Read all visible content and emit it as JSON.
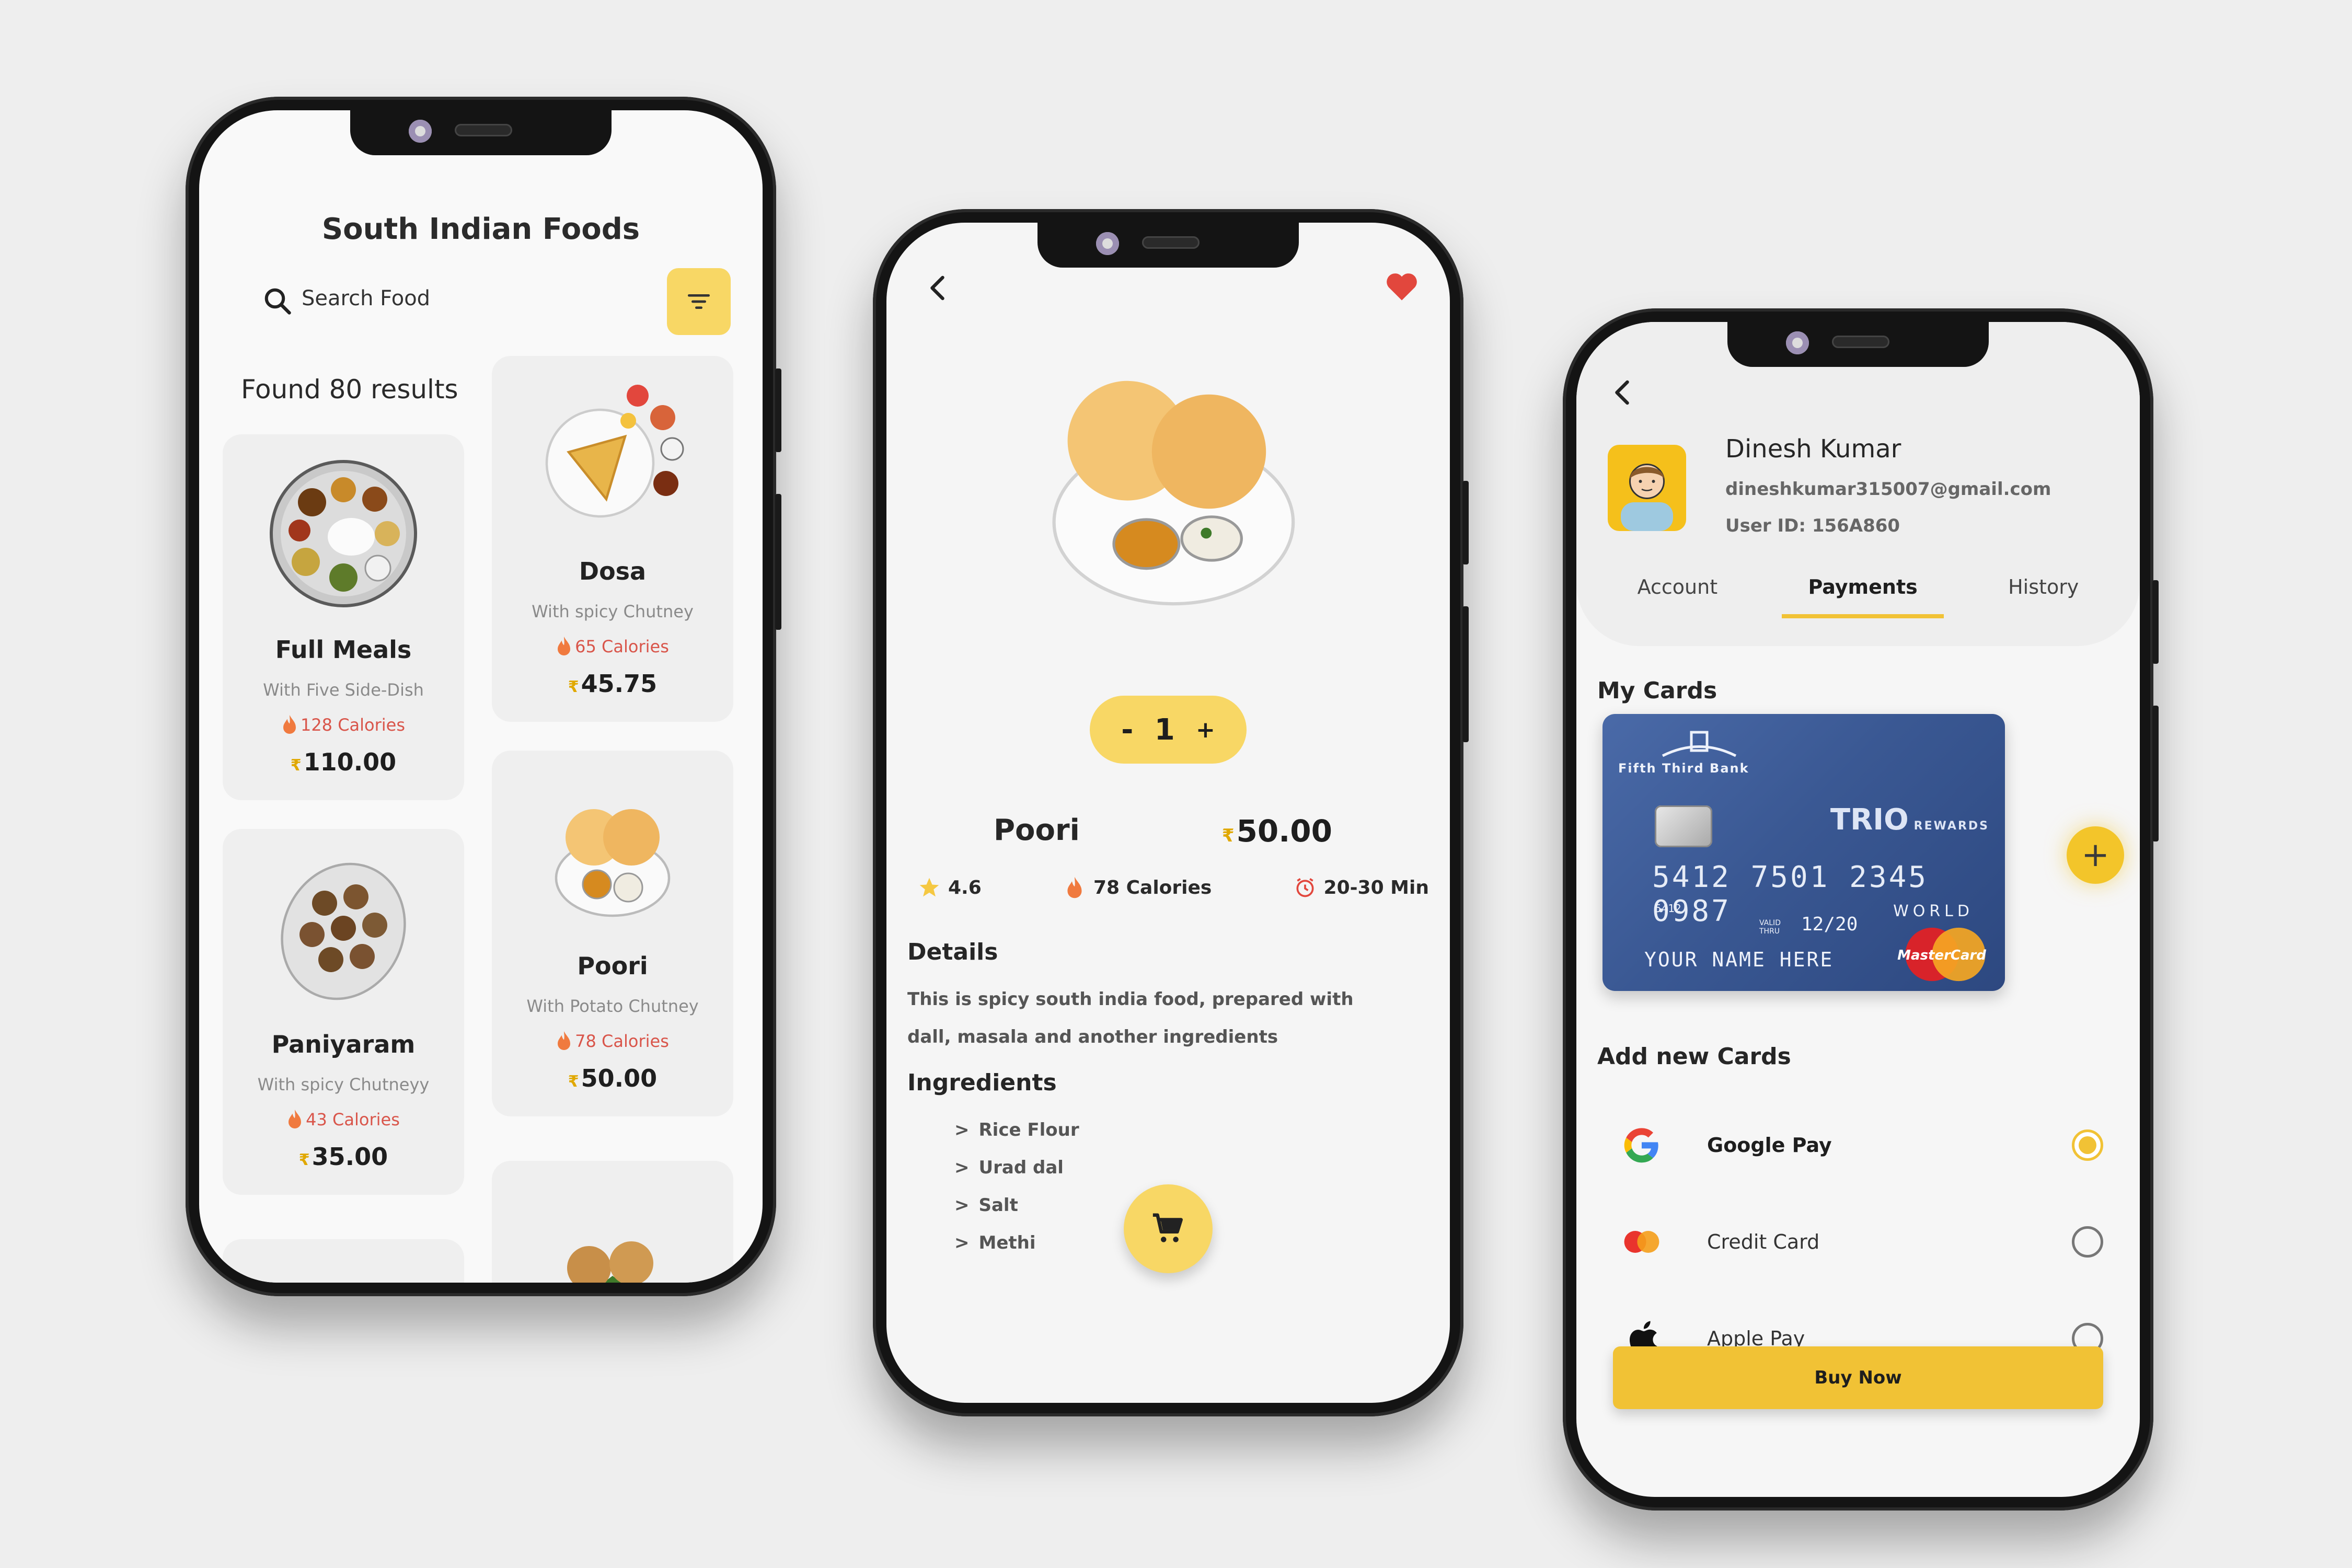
{
  "listing": {
    "title": "South Indian Foods",
    "search_placeholder": "Search Food",
    "results_text": "Found 80 results",
    "currency": "₹",
    "items": [
      {
        "name": "Full Meals",
        "desc": "With Five Side-Dish",
        "calories": "128 Calories",
        "price": "110.00"
      },
      {
        "name": "Dosa",
        "desc": "With spicy Chutney",
        "calories": "65 Calories",
        "price": "45.75"
      },
      {
        "name": "Paniyaram",
        "desc": "With spicy Chutneyy",
        "calories": "43 Calories",
        "price": "35.00"
      },
      {
        "name": "Poori",
        "desc": "With Potato Chutney",
        "calories": "78 Calories",
        "price": "50.00"
      }
    ]
  },
  "detail": {
    "quantity_minus": "-",
    "quantity": "1",
    "quantity_plus": "+",
    "name": "Poori",
    "currency": "₹",
    "price": "50.00",
    "rating": "4.6",
    "calories": "78 Calories",
    "time": "20-30 Min",
    "details_heading": "Details",
    "details_text": "This is spicy south india food, prepared with dall, masala and another ingredients",
    "ingredients_heading": "Ingredients",
    "ingredients": [
      "Rice Flour",
      "Urad dal",
      "Salt",
      "Methi"
    ]
  },
  "payment": {
    "user_name": "Dinesh Kumar",
    "email": "dineshkumar315007@gmail.com",
    "user_id": "User ID: 156A860",
    "tabs": [
      "Account",
      "Payments",
      "History"
    ],
    "my_cards_heading": "My Cards",
    "card": {
      "bank": "Fifth Third Bank",
      "brand": "TRIO",
      "brand_suffix": "REWARDS",
      "number": "5412 7501 2345 0987",
      "prefix": "5412",
      "tier": "WORLD",
      "valid_label_1": "VALID",
      "valid_label_2": "THRU",
      "expiry": "12/20",
      "holder": "YOUR NAME HERE",
      "network": "MasterCard"
    },
    "add_button": "+",
    "add_new_heading": "Add new Cards",
    "methods": [
      {
        "label": "Google Pay",
        "selected": true
      },
      {
        "label": "Credit Card",
        "selected": false
      },
      {
        "label": "Apple Pay",
        "selected": false
      }
    ],
    "buy_label": "Buy Now"
  },
  "colors": {
    "accent_yellow": "#f8d765",
    "button_yellow": "#f1c235",
    "calorie_red": "#d9554a",
    "heart_red": "#e2473d"
  }
}
